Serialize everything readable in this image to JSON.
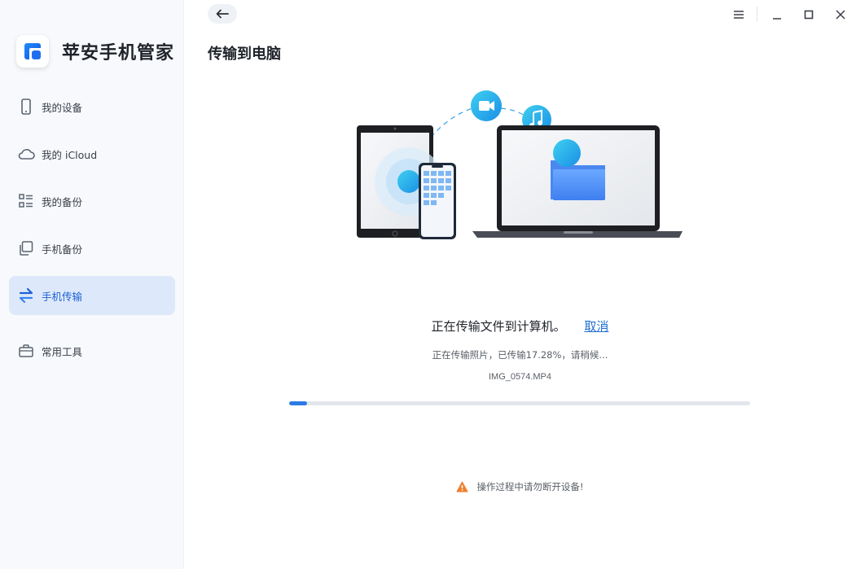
{
  "app": {
    "name": "苹安手机管家"
  },
  "sidebar": {
    "items": [
      {
        "label": "我的设备",
        "icon": "phone-icon",
        "active": false
      },
      {
        "label": "我的 iCloud",
        "icon": "cloud-icon",
        "active": false
      },
      {
        "label": "我的备份",
        "icon": "list-icon",
        "active": false
      },
      {
        "label": "手机备份",
        "icon": "copy-icon",
        "active": false
      },
      {
        "label": "手机传输",
        "icon": "transfer-icon",
        "active": true
      },
      {
        "label": "常用工具",
        "icon": "briefcase-icon",
        "active": false
      }
    ]
  },
  "header": {
    "title": "传输到电脑",
    "back_icon": "arrow-left-icon",
    "window_controls": [
      "menu-icon",
      "minimize-icon",
      "maximize-icon",
      "close-icon"
    ]
  },
  "transfer": {
    "status": "正在传输文件到计算机。",
    "cancel_label": "取消",
    "progress_text": "正在传输照片，已传输17.28%，请稍候...",
    "percent": 17.28,
    "file_name": "IMG_0574.MP4",
    "progress_bar_fill": 0.038
  },
  "warning": {
    "text": "操作过程中请勿断开设备!",
    "icon": "warning-icon"
  },
  "colors": {
    "accent": "#2b7be5",
    "active_bg": "#dde9fb",
    "sidebar_bg": "#f7f9fc",
    "warning": "#f07e2e"
  }
}
